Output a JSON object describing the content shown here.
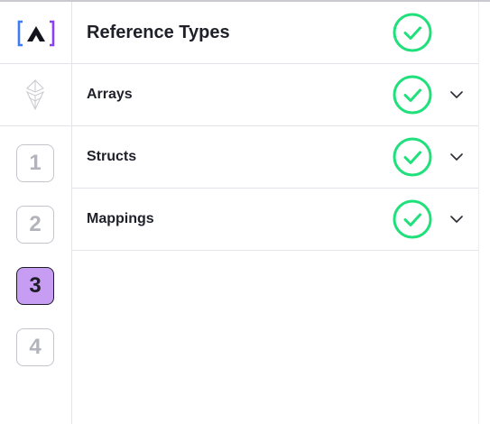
{
  "header": {
    "title": "Reference Types",
    "status_icon": "check-circle-icon"
  },
  "sections": [
    {
      "title": "Arrays",
      "status_icon": "check-circle-icon",
      "toggle_icon": "chevron-down-icon"
    },
    {
      "title": "Structs",
      "status_icon": "check-circle-icon",
      "toggle_icon": "chevron-down-icon"
    },
    {
      "title": "Mappings",
      "status_icon": "check-circle-icon",
      "toggle_icon": "chevron-down-icon"
    }
  ],
  "steps": [
    {
      "label": "1",
      "active": false
    },
    {
      "label": "2",
      "active": false
    },
    {
      "label": "3",
      "active": true
    },
    {
      "label": "4",
      "active": false
    }
  ],
  "colors": {
    "check_green": "#1fe07a",
    "active_step": "#c79df4",
    "logo_blue": "#3f7cf2",
    "logo_purple": "#8b3ff2"
  }
}
